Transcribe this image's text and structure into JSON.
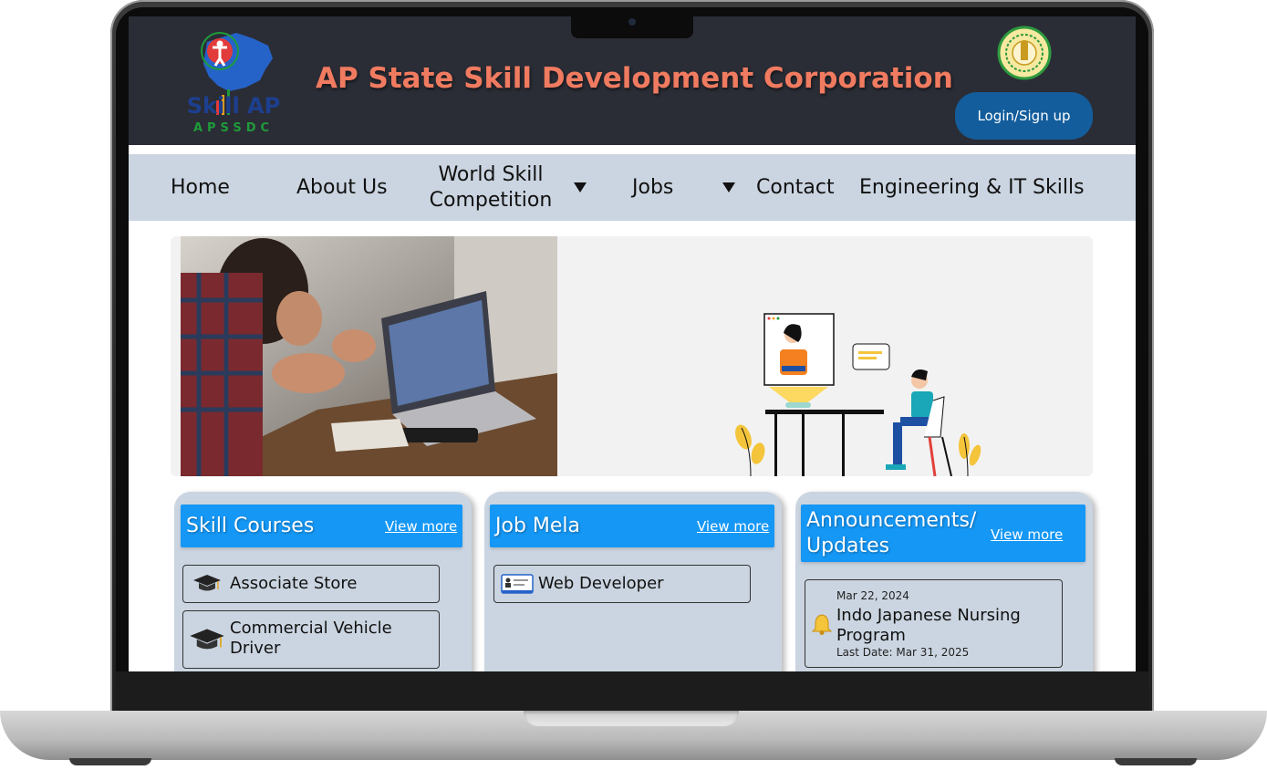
{
  "header": {
    "logo_text": "Skill AP",
    "logo_subtext": "APSSDC",
    "title": "AP State Skill Development Corporation",
    "login_label": "Login/Sign up"
  },
  "nav": {
    "items": [
      {
        "label": "Home"
      },
      {
        "label": "About Us"
      },
      {
        "label_line1": "World Skill",
        "label_line2": "Competition"
      },
      {
        "label": "Jobs"
      },
      {
        "label": "Contact"
      },
      {
        "label": "Engineering & IT Skills"
      }
    ]
  },
  "cards": {
    "skill_courses": {
      "title": "Skill Courses",
      "link": "View more",
      "items": [
        {
          "label": "Associate Store",
          "icon": "graduation-cap-icon"
        },
        {
          "label_line1": "Commercial Vehicle",
          "label_line2": "Driver",
          "icon": "graduation-cap-icon"
        }
      ]
    },
    "job_mela": {
      "title": "Job Mela",
      "link": "View more",
      "items": [
        {
          "label": "Web Developer",
          "icon": "id-card-icon"
        }
      ]
    },
    "announcements": {
      "title_line1": "Announcements/",
      "title_line2": "Updates",
      "link": "View more",
      "items": [
        {
          "date": "Mar 22, 2024",
          "title_line1": "Indo Japanese Nursing",
          "title_line2": "Program",
          "last_date": "Last Date: Mar 31, 2025",
          "icon": "bell-icon"
        }
      ]
    }
  },
  "colors": {
    "header_bg": "#2b2d36",
    "title": "#f07b60",
    "nav_bg": "#cbd5e1",
    "card_head": "#1597f5",
    "login_btn": "#135d9c"
  }
}
